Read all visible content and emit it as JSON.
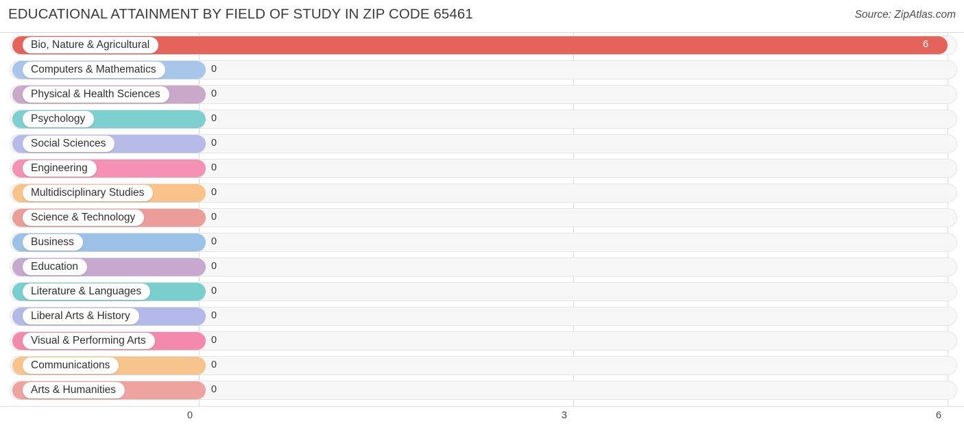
{
  "header": {
    "title": "EDUCATIONAL ATTAINMENT BY FIELD OF STUDY IN ZIP CODE 65461",
    "source": "Source: ZipAtlas.com"
  },
  "chart_data": {
    "type": "bar",
    "orientation": "horizontal",
    "title": "EDUCATIONAL ATTAINMENT BY FIELD OF STUDY IN ZIP CODE 65461",
    "xlabel": "",
    "ylabel": "",
    "xlim": [
      0,
      6
    ],
    "xticks": [
      "0",
      "3",
      "6"
    ],
    "xtick_values": [
      0,
      3,
      6
    ],
    "grid": true,
    "legend": false,
    "categories": [
      "Bio, Nature & Agricultural",
      "Computers & Mathematics",
      "Physical & Health Sciences",
      "Psychology",
      "Social Sciences",
      "Engineering",
      "Multidisciplinary Studies",
      "Science & Technology",
      "Business",
      "Education",
      "Literature & Languages",
      "Liberal Arts & History",
      "Visual & Performing Arts",
      "Communications",
      "Arts & Humanities"
    ],
    "values": [
      6,
      0,
      0,
      0,
      0,
      0,
      0,
      0,
      0,
      0,
      0,
      0,
      0,
      0,
      0
    ],
    "value_labels": [
      "6",
      "0",
      "0",
      "0",
      "0",
      "0",
      "0",
      "0",
      "0",
      "0",
      "0",
      "0",
      "0",
      "0",
      "0"
    ],
    "colors": [
      "#e4645c",
      "#a8c6ea",
      "#c9a8c9",
      "#7ed0d0",
      "#b6bbe8",
      "#f491b5",
      "#f9c288",
      "#eb9d9a",
      "#9bc2e6",
      "#c7a8cf",
      "#79cfcd",
      "#b3b9e8",
      "#f489ae",
      "#f8c48d",
      "#efa3a0"
    ]
  },
  "axis": {
    "ticks": [
      "0",
      "3",
      "6"
    ]
  }
}
